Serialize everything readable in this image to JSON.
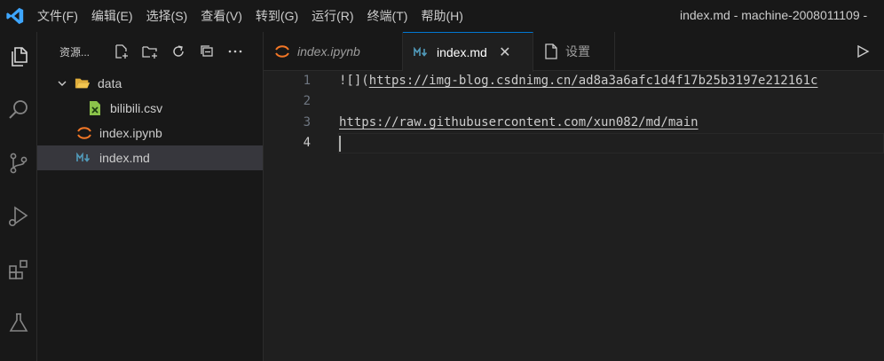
{
  "menu": {
    "items": [
      "文件(F)",
      "编辑(E)",
      "选择(S)",
      "查看(V)",
      "转到(G)",
      "运行(R)",
      "终端(T)",
      "帮助(H)"
    ]
  },
  "window_title": "index.md - machine-2008011109 -",
  "sidebar": {
    "title": "资源...",
    "tree": [
      {
        "label": "data",
        "type": "folder",
        "expanded": true
      },
      {
        "label": "bilibili.csv",
        "type": "csv"
      },
      {
        "label": "index.ipynb",
        "type": "notebook"
      },
      {
        "label": "index.md",
        "type": "markdown",
        "selected": true
      }
    ]
  },
  "tabs": [
    {
      "label": "index.ipynb",
      "icon": "jupyter-icon"
    },
    {
      "label": "index.md",
      "icon": "markdown-icon",
      "active": true,
      "close": "✕"
    },
    {
      "label": "设置",
      "icon": "file-icon"
    }
  ],
  "editor": {
    "line_numbers": [
      "1",
      "2",
      "3",
      "4"
    ],
    "line1_prefix": "![](",
    "line1_link": "https://img-blog.csdnimg.cn/ad8a3a6afc1d4f17b25b3197e212161c",
    "line3_link": "https://raw.githubusercontent.com/xun082/md/main"
  },
  "colors": {
    "accent": "#0078d4",
    "background": "#1f1f1f",
    "sidebar": "#181818"
  }
}
